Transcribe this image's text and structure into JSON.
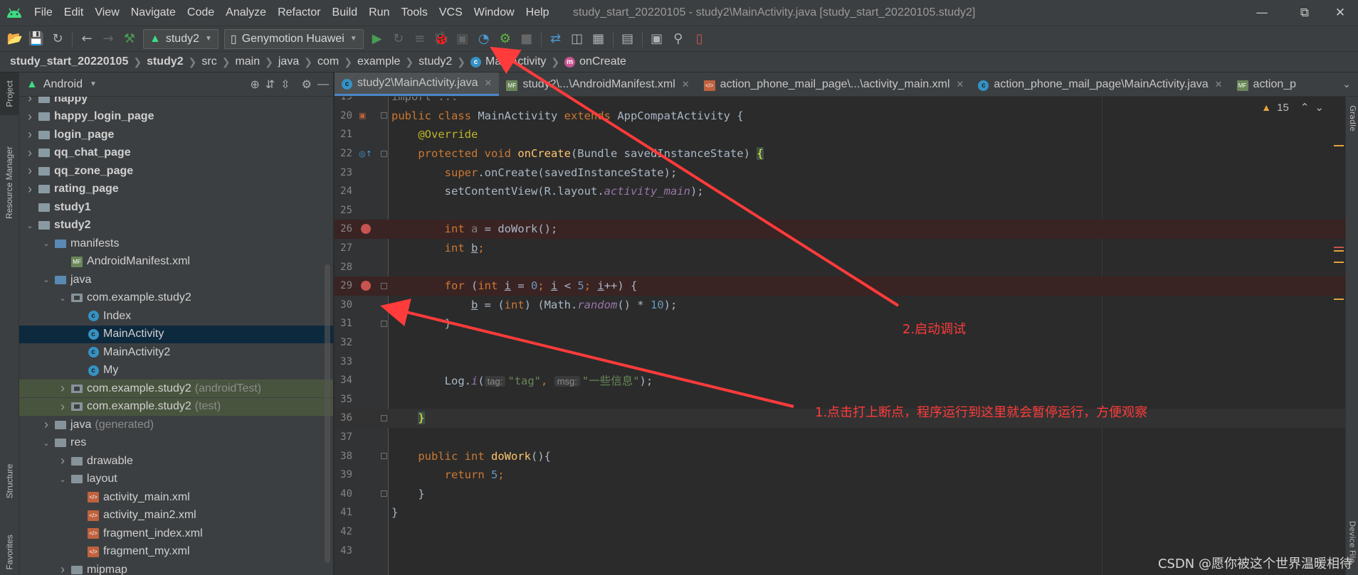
{
  "menu": {
    "items": [
      "File",
      "Edit",
      "View",
      "Navigate",
      "Code",
      "Analyze",
      "Refactor",
      "Build",
      "Run",
      "Tools",
      "VCS",
      "Window",
      "Help"
    ],
    "window_title": "study_start_20220105 - study2\\MainActivity.java [study_start_20220105.study2]"
  },
  "toolbar": {
    "module_config": "study2",
    "device": "Genymotion Huawei"
  },
  "breadcrumb": [
    "study_start_20220105",
    "study2",
    "src",
    "main",
    "java",
    "com",
    "example",
    "study2",
    "MainActivity",
    "onCreate"
  ],
  "left_stripe": {
    "project": "Project",
    "resource_manager": "Resource Manager",
    "structure": "Structure",
    "favorites": "Favorites"
  },
  "project_panel": {
    "view_mode": "Android",
    "tree": [
      {
        "label": "happy",
        "depth": 0,
        "chev": "right",
        "icon": "module",
        "bold": true
      },
      {
        "label": "happy_login_page",
        "depth": 0,
        "chev": "right",
        "icon": "module",
        "bold": true
      },
      {
        "label": "login_page",
        "depth": 0,
        "chev": "right",
        "icon": "module",
        "bold": true
      },
      {
        "label": "qq_chat_page",
        "depth": 0,
        "chev": "right",
        "icon": "module",
        "bold": true
      },
      {
        "label": "qq_zone_page",
        "depth": 0,
        "chev": "right",
        "icon": "module",
        "bold": true
      },
      {
        "label": "rating_page",
        "depth": 0,
        "chev": "right",
        "icon": "module",
        "bold": true
      },
      {
        "label": "study1",
        "depth": 0,
        "chev": "",
        "icon": "module",
        "bold": true
      },
      {
        "label": "study2",
        "depth": 0,
        "chev": "down",
        "icon": "module",
        "bold": true
      },
      {
        "label": "manifests",
        "depth": 1,
        "chev": "down",
        "icon": "folder-blue"
      },
      {
        "label": "AndroidManifest.xml",
        "depth": 2,
        "chev": "",
        "icon": "manifest"
      },
      {
        "label": "java",
        "depth": 1,
        "chev": "down",
        "icon": "folder-blue"
      },
      {
        "label": "com.example.study2",
        "depth": 2,
        "chev": "down",
        "icon": "package"
      },
      {
        "label": "Index",
        "depth": 3,
        "chev": "",
        "icon": "class"
      },
      {
        "label": "MainActivity",
        "depth": 3,
        "chev": "",
        "icon": "class",
        "selected": true
      },
      {
        "label": "MainActivity2",
        "depth": 3,
        "chev": "",
        "icon": "class"
      },
      {
        "label": "My",
        "depth": 3,
        "chev": "",
        "icon": "class"
      },
      {
        "label": "com.example.study2",
        "suffix": "(androidTest)",
        "depth": 2,
        "chev": "right",
        "icon": "package",
        "test": true
      },
      {
        "label": "com.example.study2",
        "suffix": "(test)",
        "depth": 2,
        "chev": "right",
        "icon": "package",
        "test": true
      },
      {
        "label": "java",
        "suffix": "(generated)",
        "depth": 1,
        "chev": "right",
        "icon": "folder-gen"
      },
      {
        "label": "res",
        "depth": 1,
        "chev": "down",
        "icon": "folder"
      },
      {
        "label": "drawable",
        "depth": 2,
        "chev": "right",
        "icon": "folder"
      },
      {
        "label": "layout",
        "depth": 2,
        "chev": "down",
        "icon": "folder"
      },
      {
        "label": "activity_main.xml",
        "depth": 3,
        "chev": "",
        "icon": "xml"
      },
      {
        "label": "activity_main2.xml",
        "depth": 3,
        "chev": "",
        "icon": "xml"
      },
      {
        "label": "fragment_index.xml",
        "depth": 3,
        "chev": "",
        "icon": "xml"
      },
      {
        "label": "fragment_my.xml",
        "depth": 3,
        "chev": "",
        "icon": "xml"
      },
      {
        "label": "mipmap",
        "depth": 2,
        "chev": "right",
        "icon": "folder"
      }
    ]
  },
  "tabs": [
    {
      "label": "study2\\MainActivity.java",
      "icon": "class",
      "active": true
    },
    {
      "label": "study2\\...\\AndroidManifest.xml",
      "icon": "manifest"
    },
    {
      "label": "action_phone_mail_page\\...\\activity_main.xml",
      "icon": "xml"
    },
    {
      "label": "action_phone_mail_page\\MainActivity.java",
      "icon": "class"
    },
    {
      "label": "action_p",
      "icon": "manifest"
    }
  ],
  "editor": {
    "warnings": "15",
    "folded_import": "import ...",
    "lines": [
      {
        "n": "19",
        "code": "import"
      },
      {
        "n": "20",
        "code": "class"
      },
      {
        "n": "21",
        "code": "override"
      },
      {
        "n": "22",
        "code": "oncreate"
      },
      {
        "n": "23",
        "code": "super"
      },
      {
        "n": "24",
        "code": "setcontent"
      },
      {
        "n": "25",
        "code": ""
      },
      {
        "n": "26",
        "code": "inta",
        "breakpoint": true
      },
      {
        "n": "27",
        "code": "intb"
      },
      {
        "n": "28",
        "code": ""
      },
      {
        "n": "29",
        "code": "for",
        "breakpoint": true
      },
      {
        "n": "30",
        "code": "bassign"
      },
      {
        "n": "31",
        "code": "closefor"
      },
      {
        "n": "32",
        "code": ""
      },
      {
        "n": "33",
        "code": ""
      },
      {
        "n": "34",
        "code": "log"
      },
      {
        "n": "35",
        "code": ""
      },
      {
        "n": "36",
        "code": "closemethod",
        "current": true
      },
      {
        "n": "37",
        "code": ""
      },
      {
        "n": "38",
        "code": "dowork"
      },
      {
        "n": "39",
        "code": "return"
      },
      {
        "n": "40",
        "code": "closedowork"
      },
      {
        "n": "41",
        "code": "closeclass"
      },
      {
        "n": "42",
        "code": ""
      },
      {
        "n": "43",
        "code": ""
      }
    ],
    "code": {
      "class_kw": "public class ",
      "class_name": "MainActivity ",
      "extends_kw": "extends ",
      "super_class": "AppCompatActivity {",
      "override": "@Override",
      "oncreate_mod": "protected void ",
      "oncreate_name": "onCreate",
      "oncreate_params": "(Bundle savedInstanceState) ",
      "open_brace": "{",
      "super_kw": "super",
      "super_call": ".onCreate(savedInstanceState);",
      "setcontent_pre": "setContentView(R.layout.",
      "setcontent_res": "activity_main",
      "setcontent_post": ");",
      "int_kw": "int ",
      "var_a": "a",
      "inta_rest": " = doWork();",
      "var_b": "b",
      "semicolon": ";",
      "for_kw": "for ",
      "for_open": "(",
      "var_i": "i",
      "eq": " = ",
      "zero": "0",
      "semi_sp": "; ",
      "lt": " < ",
      "five": "5",
      "pp": "++) {",
      "b_assign": " = (",
      "int_cast": "int",
      "math_pre": ") (Math.",
      "random": "random",
      "math_mid": "() * ",
      "ten": "10",
      "close_paren_semi": ");",
      "close_brace": "}",
      "log_pre": "Log.",
      "log_i": "i",
      "log_open": "(",
      "hint_tag": "tag:",
      "tag_val": "\"tag\"",
      "comma": ", ",
      "hint_msg": "msg:",
      "msg_val": "\"一些信息\"",
      "dowork_mod": "public int ",
      "dowork_name": "doWork",
      "dowork_rest": "(){",
      "return_kw": "return ",
      "return_val": "5",
      "return_semi": ";"
    }
  },
  "annotations": {
    "start_debug": "2.启动调试",
    "breakpoint_note": "1.点击打上断点，程序运行到这里就会暂停运行，方便观察"
  },
  "watermark": "CSDN @愿你被这个世界温暖相待",
  "right_stripe": {
    "gradle": "Gradle",
    "device_file": "Device File"
  },
  "colors": {
    "arrow": "#ff3b3b",
    "breakpoint": "#c75450",
    "selection": "#0d293e"
  }
}
